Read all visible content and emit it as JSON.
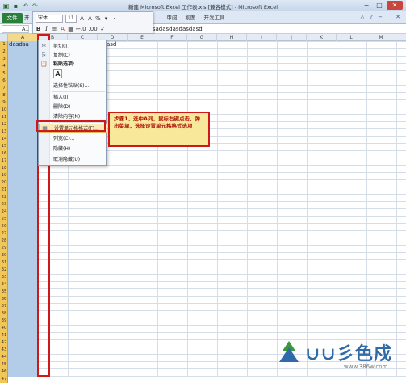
{
  "window": {
    "title": "新建 Microsoft Excel 工作表.xls [兼容模式] - Microsoft Excel",
    "qat_icons": [
      "save-icon",
      "undo-icon",
      "redo-icon"
    ],
    "controls": [
      "−",
      "□",
      "✕"
    ]
  },
  "ribbon": {
    "file_tab": "文件",
    "tabs": [
      "开",
      "审阅",
      "视图",
      "开发工具"
    ],
    "right_icons": [
      "△",
      "?",
      "−",
      "□",
      "✕"
    ]
  },
  "minibar": {
    "font": "宋体",
    "size": "11",
    "row1_buttons": [
      "A",
      "A",
      "%",
      "▾",
      "·"
    ],
    "row2_buttons": [
      "B",
      "I",
      "≡",
      "A",
      "▦",
      "←.0",
      ".00",
      "✓"
    ]
  },
  "formula_bar": {
    "name_box": "A1",
    "fx": "fx",
    "value": "dasdsadasdasdasdasd"
  },
  "grid": {
    "columns": [
      "A",
      "B",
      "C",
      "D",
      "E",
      "F",
      "G",
      "H",
      "I",
      "J",
      "K",
      "L",
      "M"
    ],
    "selected_column": "A",
    "rows": [
      "1",
      "2",
      "3",
      "4",
      "5",
      "6",
      "7",
      "8",
      "9",
      "10",
      "11",
      "12",
      "13",
      "14",
      "15",
      "16",
      "17",
      "18",
      "19",
      "20",
      "21",
      "22",
      "23",
      "24",
      "25",
      "26",
      "27",
      "28",
      "29",
      "30",
      "31",
      "32",
      "33",
      "34",
      "35",
      "36",
      "37",
      "38",
      "39",
      "40",
      "41",
      "42",
      "43",
      "44",
      "45",
      "46",
      "47"
    ],
    "cell_a1": "dasdsa",
    "cell_a1_overflow": "asd"
  },
  "context_menu": {
    "items": [
      {
        "label": "剪切(T)",
        "icon": "✂"
      },
      {
        "label": "复制(C)",
        "icon": "⎘"
      },
      {
        "label": "粘贴选项:",
        "icon": "📋"
      },
      {
        "label": "选择性粘贴(S)...",
        "icon": ""
      },
      {
        "label": "插入(I)",
        "icon": ""
      },
      {
        "label": "删除(D)",
        "icon": ""
      },
      {
        "label": "清除内容(N)",
        "icon": ""
      },
      {
        "label": "设置单元格格式(F)...",
        "icon": "▦"
      },
      {
        "label": "列宽(C)...",
        "icon": ""
      },
      {
        "label": "隐藏(H)",
        "icon": ""
      },
      {
        "label": "取消隐藏(U)",
        "icon": ""
      }
    ],
    "paste_option": "A"
  },
  "callout": {
    "text": "步骤1、选中A列，鼠标右键点击，弹出菜单，选择设置单元格格式选项"
  },
  "watermark": {
    "text": "∪∪彡色戍",
    "url": "www.386w.com"
  }
}
